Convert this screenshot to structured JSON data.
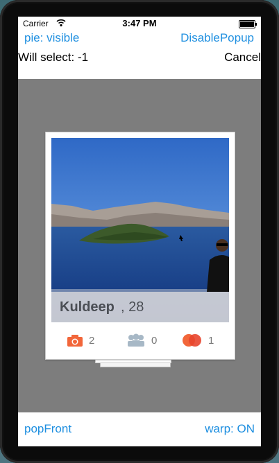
{
  "status_bar": {
    "carrier": "Carrier",
    "time": "3:47 PM"
  },
  "top_bar": {
    "pie_label": "pie: visible",
    "disable_popup_label": "DisablePopup"
  },
  "select_bar": {
    "will_select": "Will select: -1",
    "cancel_label": "Cancel"
  },
  "card": {
    "name": "Kuldeep",
    "age": ", 28",
    "stats": [
      {
        "icon": "camera-icon",
        "count": "2"
      },
      {
        "icon": "friends-icon",
        "count": "0"
      },
      {
        "icon": "interests-icon",
        "count": "1"
      }
    ]
  },
  "bottom_bar": {
    "pop_front_label": "popFront",
    "warp_label": "warp: ON"
  },
  "colors": {
    "link": "#1e8fe0",
    "camera": "#f2663a",
    "friends": "#a7b8c6",
    "interests": "#ee5a3a"
  }
}
